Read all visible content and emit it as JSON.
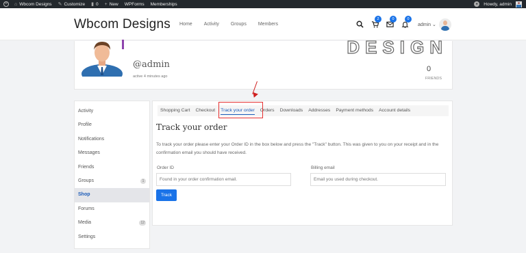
{
  "adminbar": {
    "site_name": "Wbcom Designs",
    "customize": "Customize",
    "comments_count": "0",
    "new_label": "New",
    "wpforms": "WPForms",
    "memberships": "Memberships",
    "howdy": "Howdy, admin"
  },
  "header": {
    "site_title": "Wbcom Designs",
    "nav": [
      "Home",
      "Activity",
      "Groups",
      "Members"
    ],
    "cart_count": "2",
    "messages_count": "0",
    "notifications_count": "0",
    "user_menu": "admin ⌄"
  },
  "profile": {
    "cover_text": "DESIGN",
    "username": "@admin",
    "last_active": "active 4 minutes ago",
    "friends_count": "0",
    "friends_label": "FRIENDS"
  },
  "sidebar": {
    "items": [
      {
        "label": "Activity"
      },
      {
        "label": "Profile"
      },
      {
        "label": "Notifications"
      },
      {
        "label": "Messages"
      },
      {
        "label": "Friends"
      },
      {
        "label": "Groups",
        "count": "1"
      },
      {
        "label": "Shop"
      },
      {
        "label": "Forums"
      },
      {
        "label": "Media",
        "count": "12"
      },
      {
        "label": "Settings"
      }
    ],
    "active": "Shop"
  },
  "shop": {
    "tabs": [
      "Shopping Cart",
      "Checkout",
      "Track your order",
      "Orders",
      "Downloads",
      "Addresses",
      "Payment methods",
      "Account details"
    ],
    "active_tab": "Track your order",
    "heading": "Track your order",
    "description": "To track your order please enter your Order ID in the box below and press the \"Track\" button. This was given to you on your receipt and in the confirmation email you should have received.",
    "order_id_label": "Order ID",
    "order_id_placeholder": "Found in your order confirmation email.",
    "billing_label": "Billing email",
    "billing_placeholder": "Email you used during checkout.",
    "track_button": "Track"
  },
  "colors": {
    "accent": "#1a73e8",
    "admin_bar": "#23282d",
    "annotation_red": "#e53030"
  }
}
